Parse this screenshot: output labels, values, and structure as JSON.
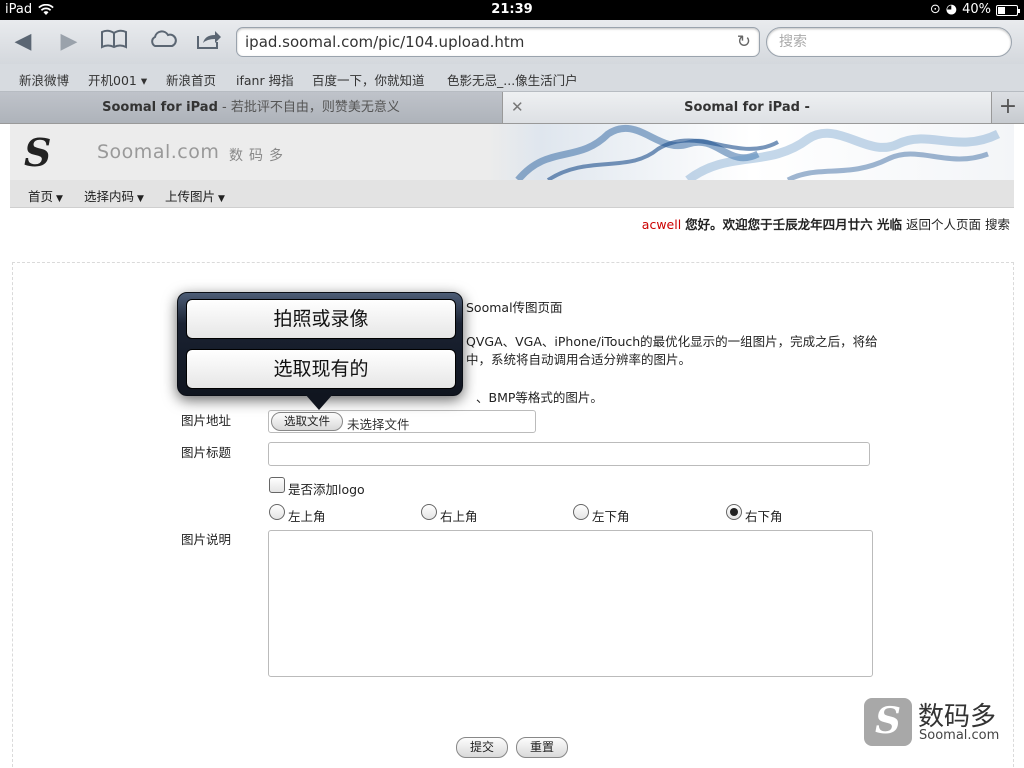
{
  "status_bar": {
    "device": "iPad",
    "time": "21:39",
    "battery": "40%",
    "battery_level": 0.4
  },
  "toolbar": {
    "back_icon": "back-arrow-icon",
    "forward_icon": "forward-arrow-icon",
    "url": "ipad.soomal.com/pic/104.upload.htm",
    "search_placeholder": "搜索"
  },
  "bookmarks": [
    "新浪微博",
    "开机001 ▾",
    "新浪首页",
    "ifanr 拇指",
    "百度一下，你就知道",
    "色影无忌_...像生活门户"
  ],
  "tabs": [
    {
      "title_bold": "Soomal for iPad",
      "title_rest": " - 若批评不自由，则赞美无意义"
    },
    {
      "title": "Soomal for iPad -"
    }
  ],
  "site": {
    "logo_letter": "S",
    "brand": "Soomal.com",
    "brand_cn": "数码多",
    "nav": [
      "首页",
      "选择内码",
      "上传图片"
    ],
    "welcome_user": "acwell",
    "welcome_greet": "您好。欢迎您于壬辰龙年四月廿六 光临",
    "welcome_links": "返回个人页面 搜索"
  },
  "page_text": {
    "line1": "Soomal传图页面",
    "line2": "QVGA、VGA、iPhone/iTouch的最优化显示的一组图片，完成之后，将给",
    "line3": "中，系统将自动调用合适分辨率的图片。",
    "line4": "、BMP等格式的图片。"
  },
  "form": {
    "file_label": "图片地址",
    "file_button": "选取文件",
    "file_status": "未选择文件",
    "title_label": "图片标题",
    "logo_checkbox": "是否添加logo",
    "positions": [
      "左上角",
      "右上角",
      "左下角",
      "右下角"
    ],
    "selected_position": "右下角",
    "desc_label": "图片说明",
    "submit": "提交",
    "reset": "重置"
  },
  "popover": {
    "option_camera": "拍照或录像",
    "option_existing": "选取现有的"
  },
  "watermark": {
    "cn": "数码多",
    "en": "Soomal.com",
    "icon_letter": "S"
  }
}
